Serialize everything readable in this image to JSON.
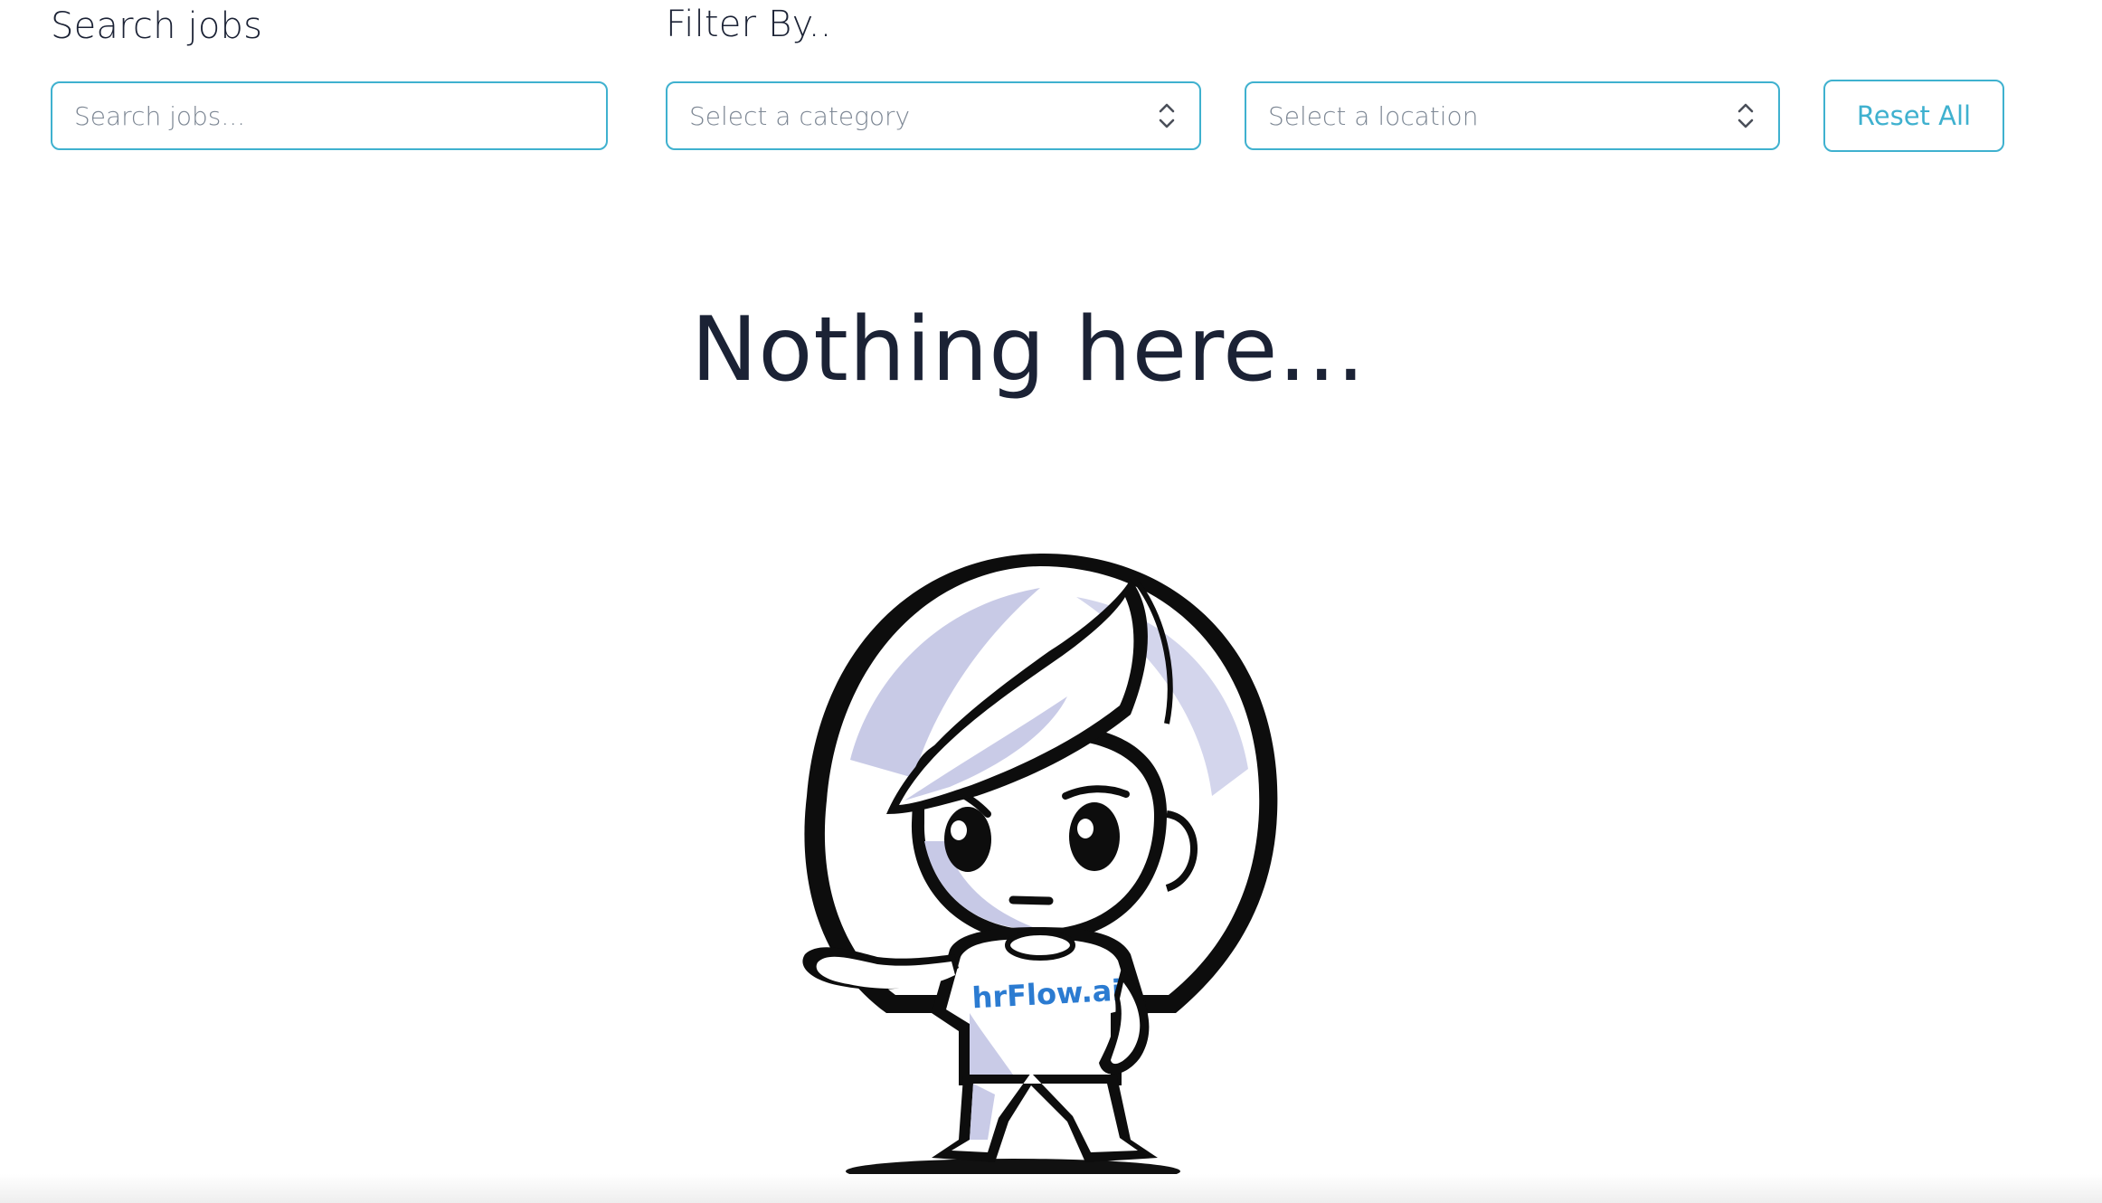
{
  "search": {
    "label": "Search jobs",
    "placeholder": "Search jobs..."
  },
  "filters": {
    "label": "Filter By..",
    "category_placeholder": "Select a category",
    "location_placeholder": "Select a location",
    "reset_label": "Reset All"
  },
  "empty_state": {
    "title": "Nothing here...",
    "mascot_shirt_text": "hrFlow.ai"
  },
  "colors": {
    "accent": "#3fb1cf",
    "text": "#1b2235",
    "placeholder": "#7d8794",
    "logo_blue": "#2b7bd1"
  }
}
